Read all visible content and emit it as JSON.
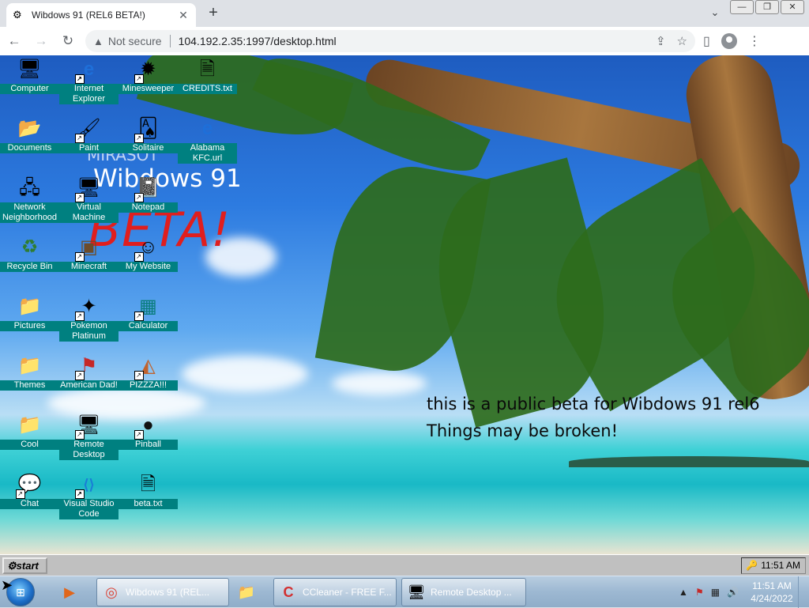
{
  "browser": {
    "tab_title": "Wibdows 91 (REL6 BETA!)",
    "tab_close": "✕",
    "new_tab": "+",
    "tab_search": "⌄",
    "window_min": "—",
    "window_restore": "❐",
    "window_close": "✕",
    "back": "←",
    "forward": "→",
    "reload": "↻",
    "security_warning_icon": "▲",
    "security_label": "Not secure",
    "url": "104.192.2.35:1997/desktop.html",
    "share_icon": "⇪",
    "star_icon": "☆",
    "sidepanel_icon": "▯",
    "menu_icon": "⋮"
  },
  "desktop": {
    "ghost_text": "MIRASOT",
    "title_text": "Wibdows 91",
    "beta_text": "BETA!",
    "notice_line1": "this is a public beta for Wibdows 91 rel6",
    "notice_line2": "Things may be broken!",
    "icons": [
      {
        "label": "Computer",
        "glyph": "🖥"
      },
      {
        "label": "Internet Explorer",
        "glyph": "e"
      },
      {
        "label": "Minesweeper",
        "glyph": "✹"
      },
      {
        "label": "CREDITS.txt",
        "glyph": "🗎"
      },
      {
        "label": "Documents",
        "glyph": "📂"
      },
      {
        "label": "Paint",
        "glyph": "🖌"
      },
      {
        "label": "Solitaire",
        "glyph": "🂡"
      },
      {
        "label": "Alabama KFC.url",
        "glyph": "e"
      },
      {
        "label": "Network Neighborhood",
        "glyph": "🖧"
      },
      {
        "label": "Virtual Machine",
        "glyph": "🖥"
      },
      {
        "label": "Notepad",
        "glyph": "📓"
      },
      {
        "label": "Recycle Bin",
        "glyph": "♻"
      },
      {
        "label": "Minecraft",
        "glyph": "▣"
      },
      {
        "label": "My Website",
        "glyph": "☺"
      },
      {
        "label": "Pictures",
        "glyph": "📁"
      },
      {
        "label": "Pokemon Platinum",
        "glyph": "✦"
      },
      {
        "label": "Calculator",
        "glyph": "▦"
      },
      {
        "label": "Themes",
        "glyph": "📁"
      },
      {
        "label": "American Dad!",
        "glyph": "⚑"
      },
      {
        "label": "PIZZZA!!!",
        "glyph": "◭"
      },
      {
        "label": "Cool",
        "glyph": "📁"
      },
      {
        "label": "Remote Desktop",
        "glyph": "🖥"
      },
      {
        "label": "Pinball",
        "glyph": "●"
      },
      {
        "label": "Chat",
        "glyph": "💬"
      },
      {
        "label": "Visual Studio Code",
        "glyph": "⟨⟩"
      },
      {
        "label": "beta.txt",
        "glyph": "🗎"
      }
    ]
  },
  "w91taskbar": {
    "start_label": "start",
    "start_icon": "⚙",
    "tray_icon": "🔑",
    "time": "11:51 AM"
  },
  "w7taskbar": {
    "start_orb": "⊞",
    "pinned": [
      {
        "name": "media-player",
        "glyph": "▶"
      },
      {
        "name": "explorer",
        "glyph": "📁"
      }
    ],
    "buttons": [
      {
        "label": "Wibdows 91 (REL...",
        "glyph": "◎"
      },
      {
        "label": "CCleaner - FREE F...",
        "glyph": "C"
      },
      {
        "label": "Remote Desktop ...",
        "glyph": "🖥"
      }
    ],
    "tray_arrow": "▲",
    "tray_flag": "⚑",
    "tray_network": "▦",
    "tray_volume": "🔊",
    "clock_time": "11:51 AM",
    "clock_date": "4/24/2022"
  }
}
